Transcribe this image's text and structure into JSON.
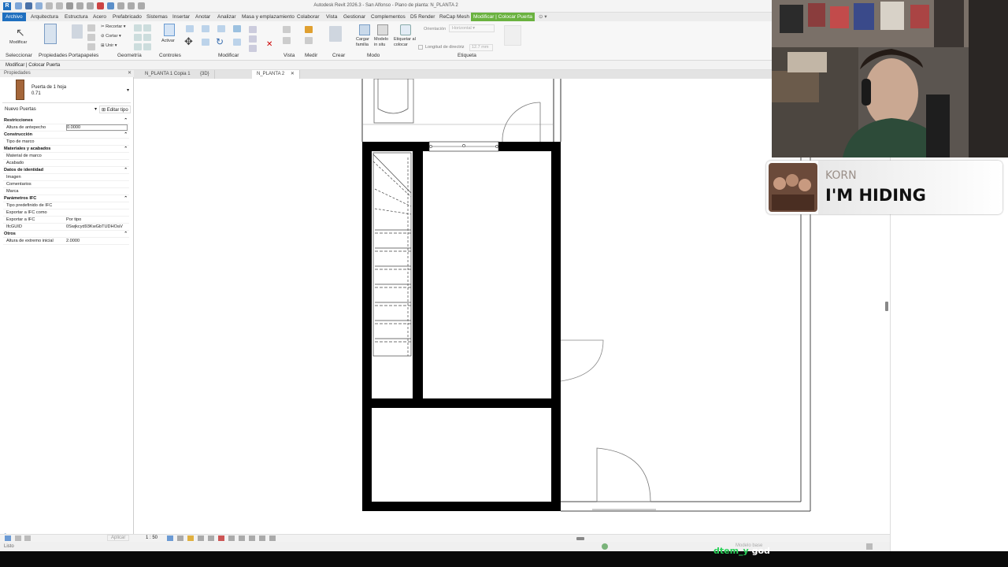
{
  "titlebar": {
    "title": "Autodesk Revit 2026.3 - San Alfonso - Plano de planta: N_PLANTA 2"
  },
  "menu": {
    "items": [
      "Archivo",
      "Arquitectura",
      "Estructura",
      "Acero",
      "Prefabricado",
      "Sistemas",
      "Insertar",
      "Anotar",
      "Analizar",
      "Masa y emplazamiento",
      "Colaborar",
      "Vista",
      "Gestionar",
      "Complementos",
      "D5 Render",
      "ReCap Mesh",
      "Modificar | Colocar Puerta"
    ]
  },
  "ribbon": {
    "panels": [
      "Seleccionar",
      "Propiedades",
      "Portapapeles",
      "Geometría",
      "Controles",
      "Modificar",
      "Vista",
      "Medir",
      "Crear",
      "Modo",
      "Etiqueta"
    ],
    "modificar": "Modificar",
    "activar": "Activar",
    "recortar": "Recortar",
    "cortar": "Cortar",
    "unir": "Unir",
    "cargar_familia": "Cargar familia",
    "modelo_in_situ": "Modelo in situ",
    "etiquetar_al_colocar": "Etiquetar al colocar",
    "orientacion": "Orientación",
    "orientacion_value": "Horizontal",
    "longitud_directriz": "Longitud de directriz",
    "longitud_value": "12.7 mm"
  },
  "context_label": "Modificar | Colocar Puerta",
  "tabs": {
    "properties": "Propiedades",
    "views": [
      "N_PLANTA 1 Copia 1",
      "{3D}",
      "N_PLANTA 2"
    ]
  },
  "properties": {
    "family": "Puerta de 1 hoja",
    "type": "0.71",
    "filter": "Nuevo Puertas",
    "edit_type": "Editar tipo",
    "rows": [
      {
        "label": "Restricciones",
        "value": "",
        "section": true
      },
      {
        "label": "Altura de antepecho",
        "value": "0.0000",
        "section": false
      },
      {
        "label": "Construcción",
        "value": "",
        "section": true
      },
      {
        "label": "Tipo de marco",
        "value": "",
        "section": false
      },
      {
        "label": "Materiales y acabados",
        "value": "",
        "section": true
      },
      {
        "label": "Material de marco",
        "value": "",
        "section": false
      },
      {
        "label": "Acabado",
        "value": "",
        "section": false
      },
      {
        "label": "Datos de identidad",
        "value": "",
        "section": true
      },
      {
        "label": "Imagen",
        "value": "",
        "section": false
      },
      {
        "label": "Comentarios",
        "value": "",
        "section": false
      },
      {
        "label": "Marca",
        "value": "",
        "section": false
      },
      {
        "label": "Parámetros IFC",
        "value": "",
        "section": true
      },
      {
        "label": "Tipo predefinido de IFC",
        "value": "",
        "section": false
      },
      {
        "label": "Exportar a IFC como",
        "value": "",
        "section": false
      },
      {
        "label": "Exportar a IFC",
        "value": "Por tipo",
        "section": false
      },
      {
        "label": "IfcGUID",
        "value": "0Swjkcyd93KwGbTUDHOaV",
        "section": false
      },
      {
        "label": "Otros",
        "value": "",
        "section": true
      },
      {
        "label": "Altura de extremo inicial",
        "value": "2.0000",
        "section": false
      }
    ],
    "apply": "Aplicar"
  },
  "status": {
    "scale": "1 : 50",
    "ready": "Listo",
    "model": "Modelo base"
  },
  "music": {
    "artist": "KORN",
    "song": "I'M HIDING"
  },
  "chat": {
    "user": "dtem_y",
    "text": "god"
  },
  "colors": {
    "accent": "#1f6fbf",
    "context_tab": "#6ab23f",
    "wall": "#000000"
  }
}
